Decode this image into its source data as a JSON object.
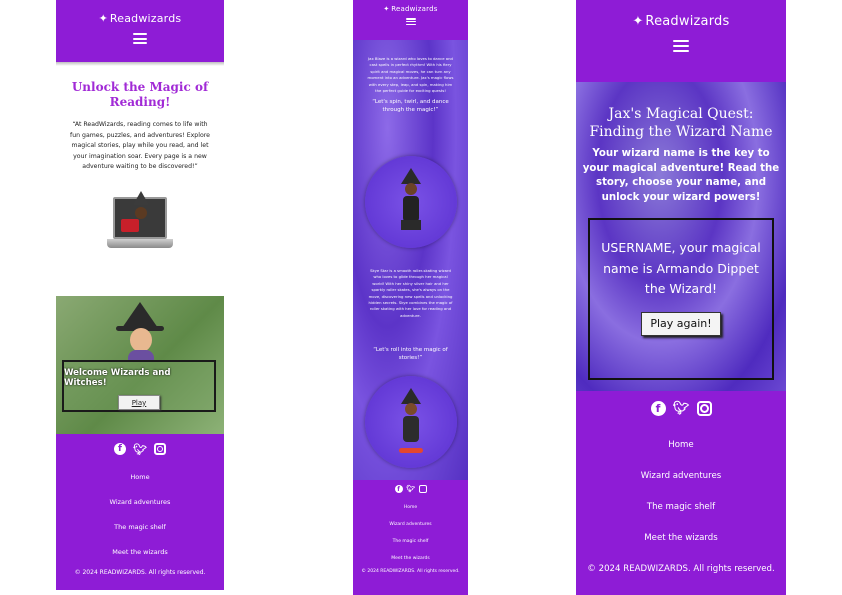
{
  "brand": {
    "name": "Readwizards",
    "wand_icon": "magic-wand-icon"
  },
  "colors": {
    "header_purple": "#8e1cd6",
    "title_purple": "#a12ad6",
    "wizard_violet": "#6a3fd0"
  },
  "footer": {
    "nav": [
      "Home",
      "Wizard adventures",
      "The magic shelf",
      "Meet the wizards"
    ],
    "copyright": "© 2024 READWIZARDS. All rights reserved.",
    "socials": [
      "facebook-icon",
      "twitter-icon",
      "instagram-icon"
    ]
  },
  "screen1": {
    "title": "Unlock the Magic of Reading!",
    "intro": "“At ReadWizards, reading comes to life with fun games, puzzles, and adventures! Explore magical stories, play while you read, and let your imagination soar. Every page is a new adventure waiting to be discovered!”",
    "welcome": "Welcome Wizards and Witches!",
    "play": "Play"
  },
  "screen2": {
    "jax_text": "Jax Blaze is a wizard who loves to dance and cast spells in perfect rhythm! With his fiery spirit and magical moves, he can turn any moment into an adventure. Jax's magic flows with every step, leap, and spin, making him the perfect guide for exciting quests!",
    "jax_quote": "“Let's spin, twirl, and dance through the magic!”",
    "skye_text": "Skye Star is a smooth roller-skating wizard who loves to glide through her magical world! With her shiny silver hair and her sparkly roller skates, she's always on the move, discovering new spells and unlocking hidden secrets. Skye combines the magic of roller skating with her love for reading and adventure.",
    "skye_quote": "“Let's roll into the magic of stories!”"
  },
  "screen3": {
    "title": "Jax's Magical Quest: Finding the Wizard Name",
    "text": "Your wizard name is the key to your magical adventure! Read the story, choose your name, and unlock your wizard powers!",
    "result": "USERNAME, your magical name is Armando Dippet the Wizard!",
    "play_again": "Play again!"
  }
}
